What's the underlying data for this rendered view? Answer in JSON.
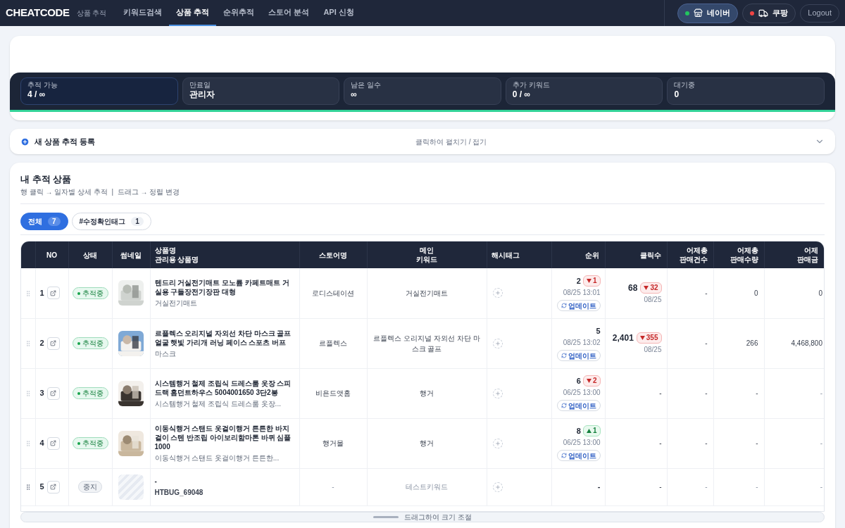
{
  "nav": {
    "logo": "CHEATCODE",
    "subtitle": "상품 추적",
    "tabs": [
      {
        "label": "키워드검색",
        "selected": false
      },
      {
        "label": "상품 추적",
        "selected": true
      },
      {
        "label": "순위추적",
        "selected": false
      },
      {
        "label": "스토어 분석",
        "selected": false
      },
      {
        "label": "API 신청",
        "selected": false
      }
    ],
    "platforms": [
      {
        "label": "네이버",
        "kind": "store",
        "color": "#22c55e",
        "selected": true
      },
      {
        "label": "쿠팡",
        "kind": "truck",
        "color": "#ef4444",
        "selected": false
      }
    ],
    "logout": "Logout"
  },
  "stats": [
    {
      "label": "추적 가능",
      "value": "4 / ∞",
      "selected": true
    },
    {
      "label": "만료일",
      "value": "관리자",
      "selected": false
    },
    {
      "label": "남은 일수",
      "value": "∞",
      "selected": false
    },
    {
      "label": "추가 키워드",
      "value": "0 / ∞",
      "selected": false
    },
    {
      "label": "대기중",
      "value": "0",
      "selected": false
    }
  ],
  "register": {
    "title": "새 상품 추적 등록",
    "hint": "클릭하여 펼치기 / 접기",
    "expanded": false
  },
  "tracked": {
    "title": "내 추적 상품",
    "subtitle": "행 클릭 → 일자별 상세 추적  |  드래그 → 정렬 변경",
    "filters": [
      {
        "label": "전체",
        "count": "7",
        "selected": true
      },
      {
        "label": "#수정확인태그",
        "count": "1",
        "selected": false
      }
    ],
    "columns": [
      {
        "label": "NO"
      },
      {
        "label": "상태"
      },
      {
        "label": "썸네일"
      },
      {
        "label": "상품명",
        "sub": "관리용 상품명"
      },
      {
        "label": "스토어명"
      },
      {
        "label": "메인",
        "sub": "키워드"
      },
      {
        "label": "해시태그"
      },
      {
        "label": "순위"
      },
      {
        "label": "클릭수"
      },
      {
        "label": "어제총",
        "sub": "판매건수"
      },
      {
        "label": "어제총",
        "sub": "판매수량"
      },
      {
        "label": "어제",
        "sub": "판매금"
      }
    ],
    "rows": [
      {
        "no": "1",
        "status": "추적중",
        "active": true,
        "kind": "picture",
        "name": "텐드리 거실전기매트 모노륨 카페트매트 거실용 구들장전기장판 대형",
        "admin_name": "거실전기매트",
        "store": "로디스테이션",
        "keyword": "거실전기매트",
        "rank": "2",
        "rank_change": {
          "kind": "down",
          "value": "1"
        },
        "rank_date": "08/25 13:01",
        "update": "업데이트",
        "clicks": "68",
        "click_change": {
          "kind": "down",
          "value": "32"
        },
        "click_date": "08/25",
        "orders": "-",
        "quantity": "0",
        "amount": "0"
      },
      {
        "no": "2",
        "status": "추적중",
        "active": true,
        "kind": "picture",
        "name": "르플렉스 오리지널 자외선 차단 마스크 골프 얼굴 햇빛 가리개 러닝 페이스 스포츠 버프",
        "admin_name": "마스크",
        "store": "르플렉스",
        "keyword": "르플렉스 오리지널 자외선 차단 마스크 골프",
        "rank": "5",
        "rank_date": "08/25 13:02",
        "update": "업데이트",
        "clicks": "2,401",
        "click_change": {
          "kind": "down",
          "value": "355"
        },
        "click_date": "08/25",
        "orders": "-",
        "quantity": "266",
        "amount": "4,468,800"
      },
      {
        "no": "3",
        "status": "추적중",
        "active": true,
        "kind": "picture",
        "name": "시스템행거 철제 조립식 드레스룸 옷장 스피드랙 홈던트하우스 5004001650 3단2봉",
        "admin_name": "시스템행거 철제 조립식 드레스룸 옷장...",
        "store": "비욘드앳홈",
        "keyword": "행거",
        "rank": "6",
        "rank_change": {
          "kind": "down",
          "value": "2"
        },
        "rank_date": "06/25 13:00",
        "update": "업데이트",
        "clicks": "-",
        "orders": "-",
        "quantity": "-",
        "amount": "-"
      },
      {
        "no": "4",
        "status": "추적중",
        "active": true,
        "kind": "picture",
        "name": "이동식행거 스탠드 옷걸이행거 튼튼한 바지걸이 스텐 반조립 아이보리함마톤 바퀴 심플1000",
        "admin_name": "이동식행거 스탠드 옷걸이행거 튼튼한...",
        "store": "행거몰",
        "keyword": "행거",
        "rank": "8",
        "rank_change": {
          "kind": "up",
          "value": "1"
        },
        "rank_date": "06/25 13:00",
        "update": "업데이트",
        "clicks": "-",
        "orders": "-",
        "quantity": "-",
        "amount": "-"
      },
      {
        "no": "5",
        "status": "중지",
        "active": false,
        "kind": "placeholder",
        "name": "-",
        "admin_name": "HTBUG_69048",
        "store": "-",
        "keyword": "테스트키워드",
        "rank": "-",
        "clicks": "-",
        "orders": "-",
        "quantity": "-",
        "amount": "-"
      }
    ],
    "resize_hint": "드래그하여 크기 조절"
  }
}
